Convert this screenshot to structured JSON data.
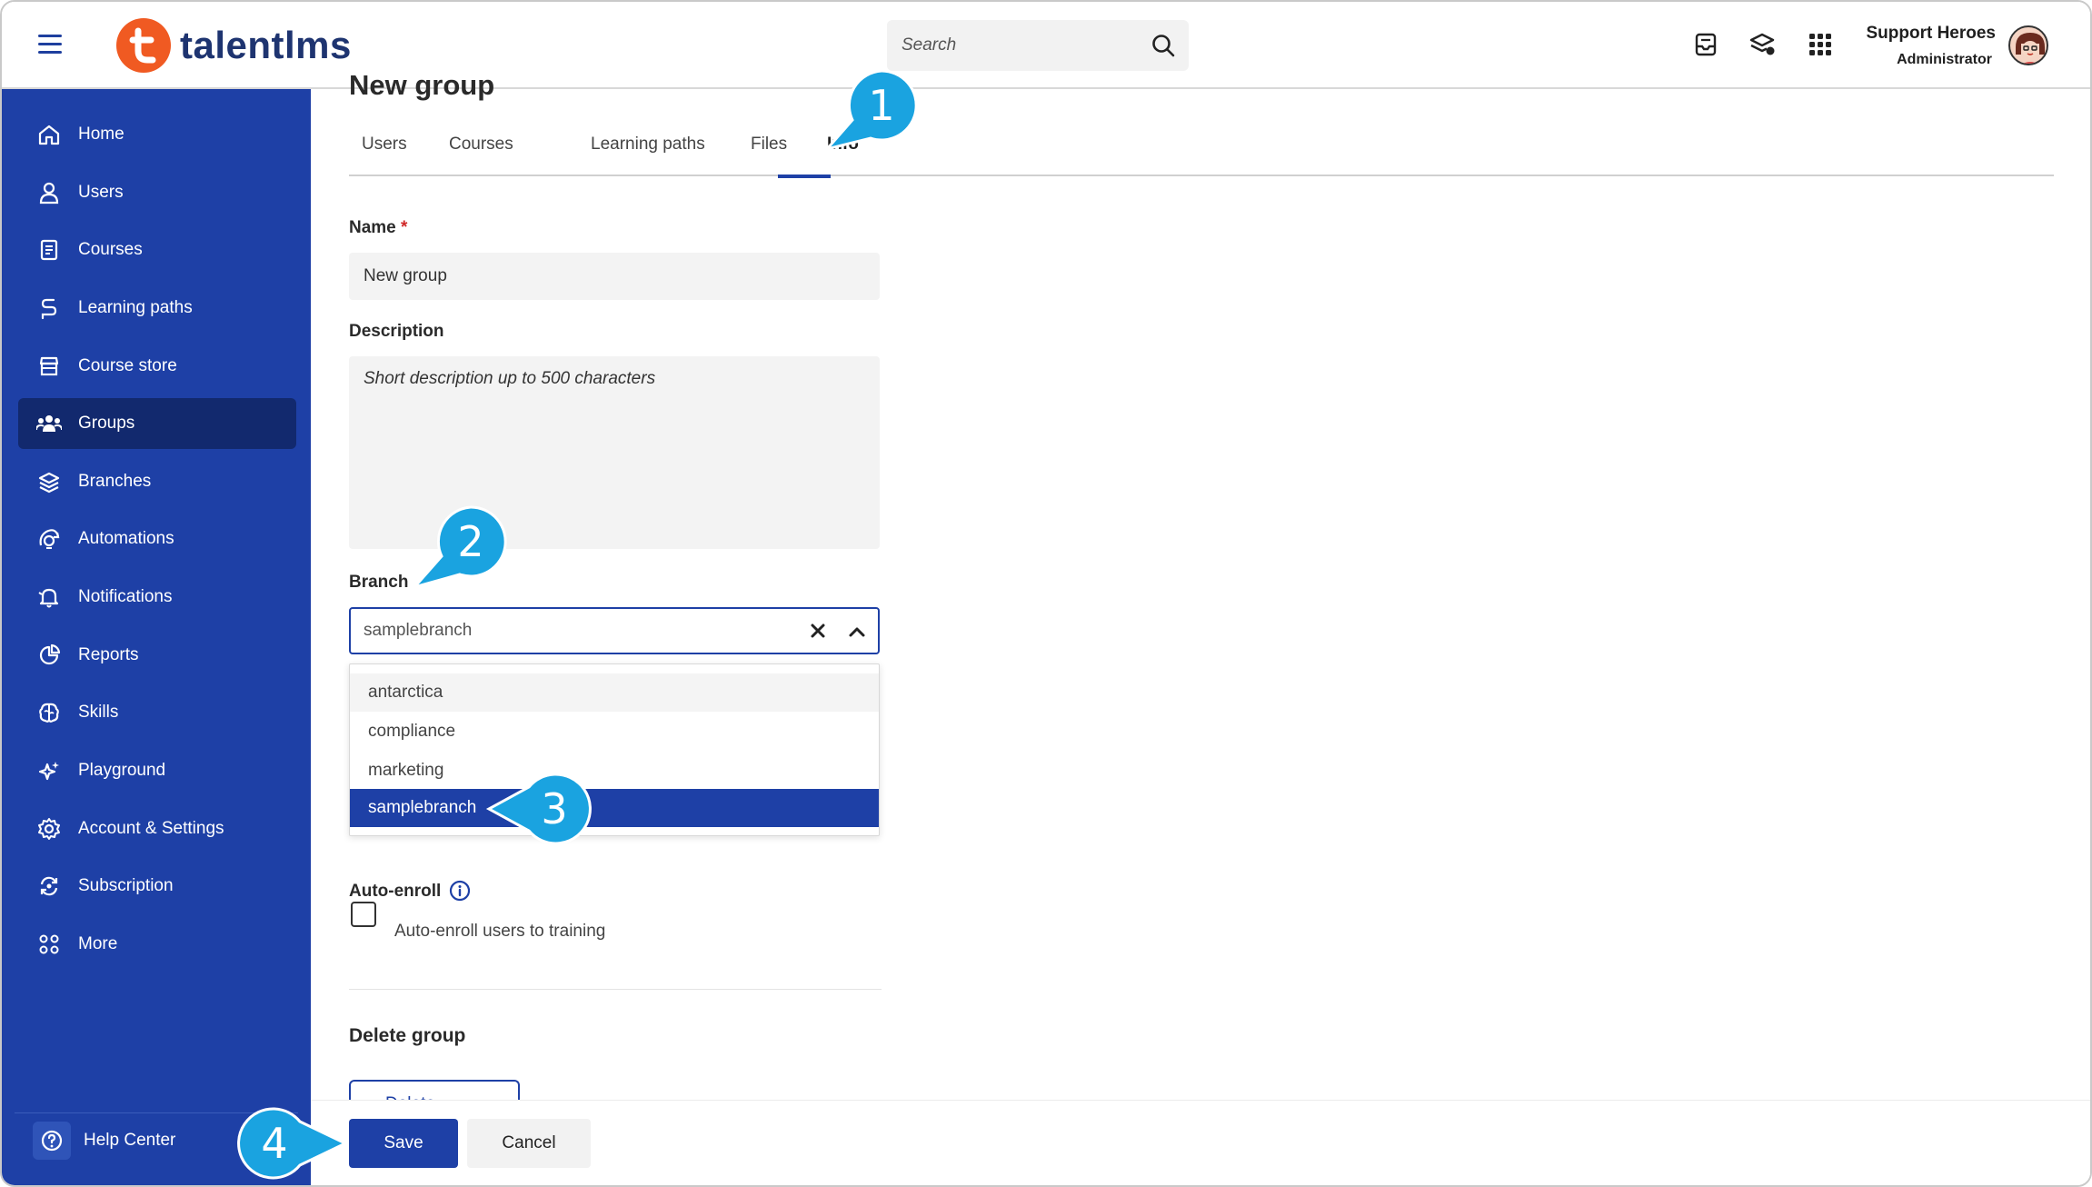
{
  "header": {
    "logo_text": "talentlms",
    "search_placeholder": "Search",
    "user_name": "Support Heroes",
    "user_role": "Administrator"
  },
  "sidebar": {
    "items": [
      {
        "label": "Home",
        "icon": "home-icon"
      },
      {
        "label": "Users",
        "icon": "user-icon"
      },
      {
        "label": "Courses",
        "icon": "book-icon"
      },
      {
        "label": "Learning paths",
        "icon": "path-icon"
      },
      {
        "label": "Course store",
        "icon": "store-icon"
      },
      {
        "label": "Groups",
        "icon": "groups-icon",
        "active": true
      },
      {
        "label": "Branches",
        "icon": "layers-icon"
      },
      {
        "label": "Automations",
        "icon": "automation-icon"
      },
      {
        "label": "Notifications",
        "icon": "bell-icon"
      },
      {
        "label": "Reports",
        "icon": "pie-chart-icon"
      },
      {
        "label": "Skills",
        "icon": "brain-icon"
      },
      {
        "label": "Playground",
        "icon": "sparkle-icon"
      },
      {
        "label": "Account & Settings",
        "icon": "gear-icon"
      },
      {
        "label": "Subscription",
        "icon": "refresh-icon"
      },
      {
        "label": "More",
        "icon": "grid-icon"
      }
    ],
    "help_label": "Help Center"
  },
  "main": {
    "page_title": "New group",
    "tabs": [
      "Users",
      "Courses",
      "Learning paths",
      "Files",
      "Info"
    ],
    "active_tab": "Info",
    "name_label": "Name",
    "name_required": "*",
    "name_value": "New group",
    "description_label": "Description",
    "description_placeholder": "Short description up to 500 characters",
    "branch_label": "Branch",
    "branch_value": "samplebranch",
    "branch_options": [
      "antarctica",
      "compliance",
      "marketing",
      "samplebranch"
    ],
    "branch_selected": "samplebranch",
    "autoenroll_label": "Auto-enroll",
    "autoenroll_checkbox_label": "Auto-enroll users to training",
    "delete_title": "Delete group",
    "delete_button": "Delete",
    "save_button": "Save",
    "cancel_button": "Cancel"
  },
  "callouts": [
    "1",
    "2",
    "3",
    "4"
  ],
  "colors": {
    "sidebar_bg": "#1e40a6",
    "sidebar_active": "#12296e",
    "accent": "#1e40a6",
    "logo_orange": "#f05a22",
    "callout": "#1aa3e0"
  }
}
